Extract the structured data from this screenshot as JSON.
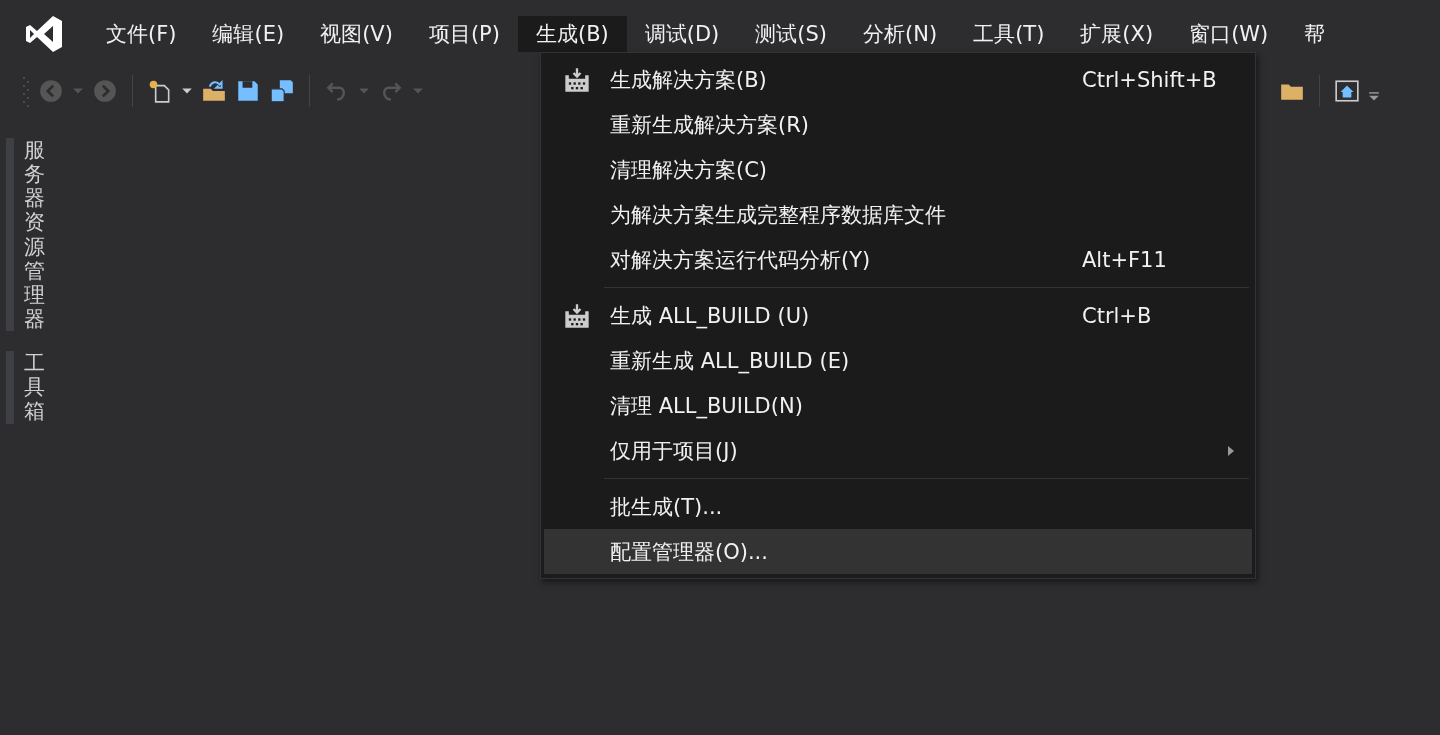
{
  "menu_bar": [
    {
      "label": "文件(F)",
      "selected": false
    },
    {
      "label": "编辑(E)",
      "selected": false
    },
    {
      "label": "视图(V)",
      "selected": false
    },
    {
      "label": "项目(P)",
      "selected": false
    },
    {
      "label": "生成(B)",
      "selected": true
    },
    {
      "label": "调试(D)",
      "selected": false
    },
    {
      "label": "测试(S)",
      "selected": false
    },
    {
      "label": "分析(N)",
      "selected": false
    },
    {
      "label": "工具(T)",
      "selected": false
    },
    {
      "label": "扩展(X)",
      "selected": false
    },
    {
      "label": "窗口(W)",
      "selected": false
    },
    {
      "label": "帮",
      "selected": false
    }
  ],
  "side_tabs": [
    {
      "label": "服务器资源管理器"
    },
    {
      "label": "工具箱"
    }
  ],
  "dropdown": {
    "items": [
      {
        "kind": "item",
        "label": "生成解决方案(B)",
        "shortcut": "Ctrl+Shift+B",
        "has_icon": true,
        "submenu": false,
        "selected": false
      },
      {
        "kind": "item",
        "label": "重新生成解决方案(R)",
        "has_icon": false,
        "submenu": false,
        "selected": false
      },
      {
        "kind": "item",
        "label": "清理解决方案(C)",
        "has_icon": false,
        "submenu": false,
        "selected": false
      },
      {
        "kind": "item",
        "label": "为解决方案生成完整程序数据库文件",
        "has_icon": false,
        "submenu": false,
        "selected": false
      },
      {
        "kind": "item",
        "label": "对解决方案运行代码分析(Y)",
        "shortcut": "Alt+F11",
        "has_icon": false,
        "submenu": false,
        "selected": false
      },
      {
        "kind": "separator"
      },
      {
        "kind": "item",
        "label": "生成 ALL_BUILD (U)",
        "shortcut": "Ctrl+B",
        "has_icon": true,
        "submenu": false,
        "selected": false
      },
      {
        "kind": "item",
        "label": "重新生成 ALL_BUILD (E)",
        "has_icon": false,
        "submenu": false,
        "selected": false
      },
      {
        "kind": "item",
        "label": "清理 ALL_BUILD(N)",
        "has_icon": false,
        "submenu": false,
        "selected": false
      },
      {
        "kind": "item",
        "label": "仅用于项目(J)",
        "has_icon": false,
        "submenu": true,
        "selected": false
      },
      {
        "kind": "separator"
      },
      {
        "kind": "item",
        "label": "批生成(T)...",
        "has_icon": false,
        "submenu": false,
        "selected": false
      },
      {
        "kind": "item",
        "label": "配置管理器(O)...",
        "has_icon": false,
        "submenu": false,
        "selected": true
      }
    ]
  }
}
